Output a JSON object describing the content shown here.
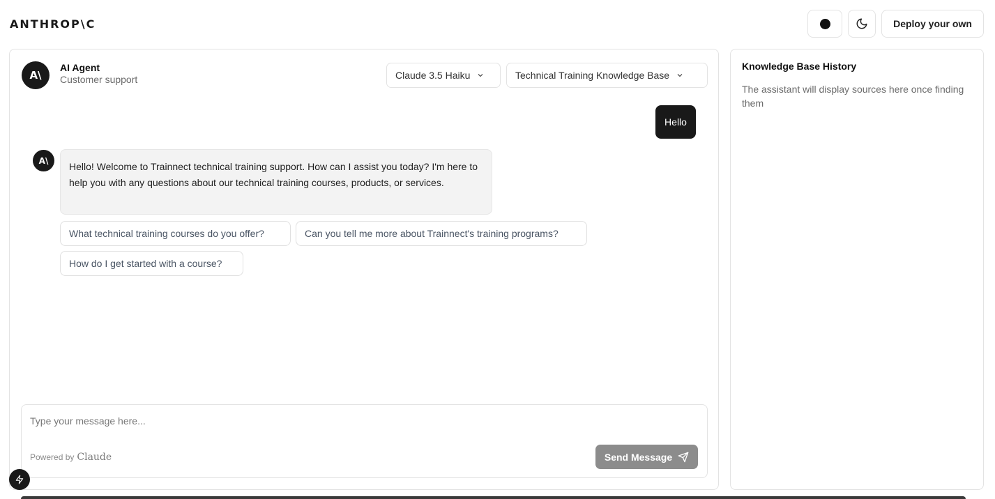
{
  "brand": {
    "logo_text": "ANTHROP\\C"
  },
  "topbar": {
    "record_icon": "record-dot-icon",
    "theme_icon": "moon-icon",
    "deploy_label": "Deploy your own"
  },
  "agent": {
    "avatar_text": "A\\",
    "name": "AI Agent",
    "role": "Customer support"
  },
  "selectors": {
    "model": "Claude 3.5 Haiku",
    "knowledge_base": "Technical Training Knowledge Base"
  },
  "messages": [
    {
      "from": "user",
      "text": "Hello"
    },
    {
      "from": "assistant",
      "avatar_text": "A\\",
      "text": "Hello! Welcome to Trainnect technical training support. How can I assist you today? I'm here to help you with any questions about our technical training courses, products, or services."
    }
  ],
  "suggestions": [
    "What technical training courses do you offer?",
    "Can you tell me more about Trainnect's training programs?",
    "How do I get started with a course?"
  ],
  "composer": {
    "placeholder": "Type your message here...",
    "powered_by": "Powered by",
    "powered_brand": "Claude",
    "send_label": "Send Message",
    "send_icon": "paper-plane-icon"
  },
  "side_panel": {
    "title": "Knowledge Base History",
    "empty_text": "The assistant will display sources here once finding them"
  },
  "colors": {
    "primary_dark": "#191919",
    "border": "#e3e3e3",
    "send_disabled": "#8c8c8c",
    "bubble_bg": "#f3f3f3"
  }
}
